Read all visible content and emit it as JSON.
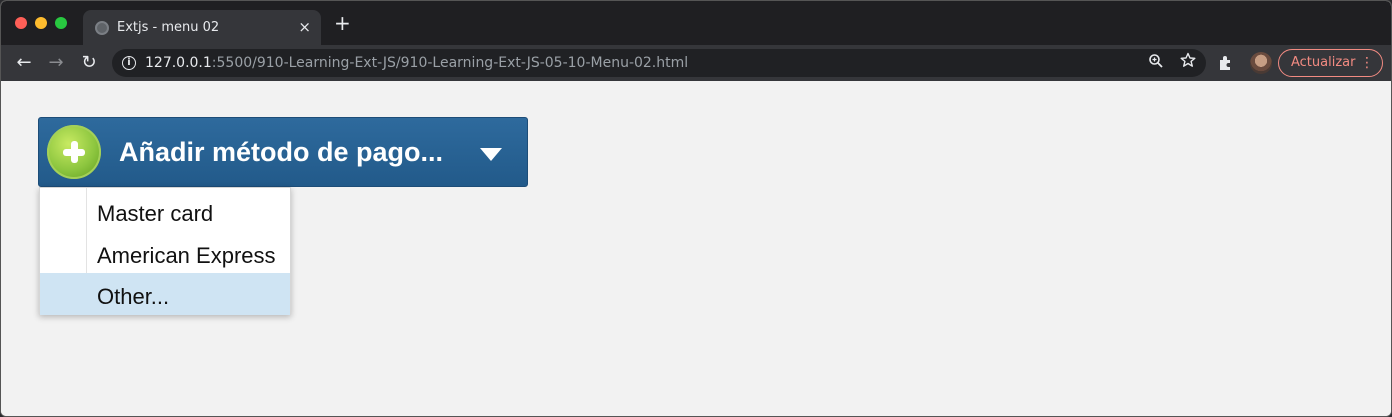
{
  "browser": {
    "tab": {
      "title": "Extjs - menu 02",
      "close": "×"
    },
    "new_tab": "+",
    "nav": {
      "back": "←",
      "forward": "→",
      "reload": "↻"
    },
    "url": {
      "host": "127.0.0.1",
      "path": ":5500/910-Learning-Ext-JS/910-Learning-Ext-JS-05-10-Menu-02.html"
    },
    "update_button": {
      "label": "Actualizar",
      "more": "⋮"
    }
  },
  "page": {
    "split_button": {
      "label": "Añadir método de pago..."
    },
    "menu": {
      "items": [
        {
          "label": "Master card"
        },
        {
          "label": "American Express"
        },
        {
          "label": "Other...",
          "highlighted": true
        }
      ]
    }
  },
  "colors": {
    "button_bg": "#2a6496",
    "menu_highlight": "#cfe4f3",
    "update_accent": "#f28b82"
  }
}
